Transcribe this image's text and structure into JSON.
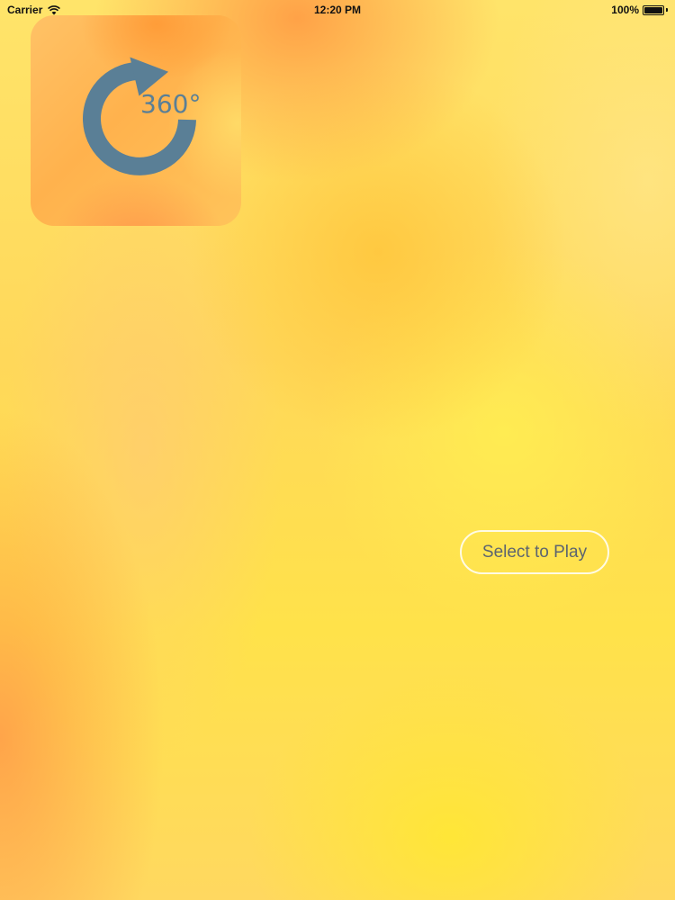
{
  "status_bar": {
    "carrier": "Carrier",
    "time": "12:20 PM",
    "battery": "100%",
    "wifi_icon": "wifi-icon",
    "battery_icon": "battery-icon"
  },
  "app_icon": {
    "label": "360°",
    "icon": "rotate-360-icon",
    "icon_color": "#5a7f96"
  },
  "play_button": {
    "label": "Select to Play"
  }
}
